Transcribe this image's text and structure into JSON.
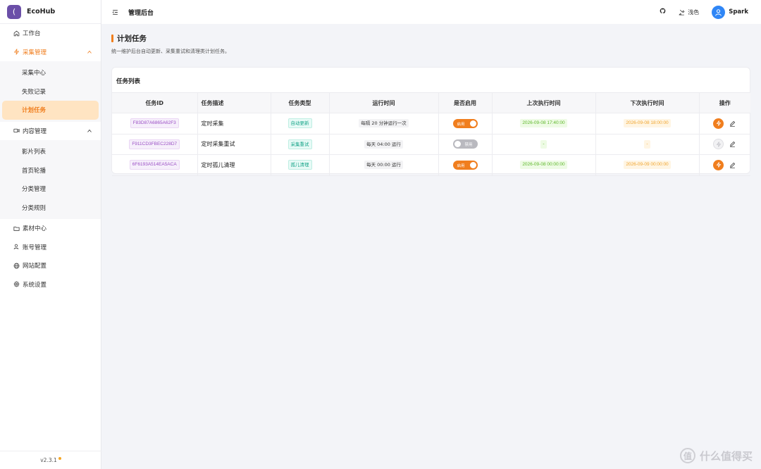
{
  "brand": {
    "logo_glyph": "(",
    "name": "EcoHub",
    "logo_color": "#6b4fa8"
  },
  "header": {
    "title": "管理后台",
    "theme_label": "浅色",
    "user_name": "Spark"
  },
  "sidebar": {
    "items": [
      {
        "label": "工作台",
        "icon": "home-icon"
      },
      {
        "label": "采集管理",
        "icon": "lightning-icon",
        "expanded": true,
        "children": [
          "采集中心",
          "失败记录",
          "计划任务"
        ]
      },
      {
        "label": "内容管理",
        "icon": "video-icon",
        "expanded": true,
        "children": [
          "影片列表",
          "首页轮播",
          "分类管理",
          "分类规则"
        ]
      },
      {
        "label": "素材中心",
        "icon": "folder-icon"
      },
      {
        "label": "账号管理",
        "icon": "user-icon"
      },
      {
        "label": "网站配置",
        "icon": "globe-icon"
      },
      {
        "label": "系统设置",
        "icon": "gear-icon"
      }
    ],
    "active_child": "计划任务",
    "version": "v2.3.1"
  },
  "page": {
    "title": "计划任务",
    "description": "统一维护后台自动更新、采集重试和清理类计划任务。"
  },
  "card": {
    "title": "任务列表"
  },
  "table": {
    "headers": [
      "任务ID",
      "任务描述",
      "任务类型",
      "运行时间",
      "是否启用",
      "上次执行时间",
      "下次执行时间",
      "操作"
    ],
    "rows": [
      {
        "id": "F83D87A6865A62F3",
        "desc": "定时采集",
        "type": "自动更新",
        "schedule": "每隔 20 分钟运行一次",
        "enabled": true,
        "switch_label": "启用",
        "last_run": "2026-09-08 17:40:00",
        "next_run": "2026-09-08 18:00:00"
      },
      {
        "id": "F911CD3FBEC228D7",
        "desc": "定时采集重试",
        "type": "采集重试",
        "schedule": "每天 04:00 运行",
        "enabled": false,
        "switch_label": "禁用",
        "last_run": "-",
        "next_run": "-"
      },
      {
        "id": "6F6193A514EA5ACA",
        "desc": "定时孤儿清理",
        "type": "孤儿清理",
        "schedule": "每天 00:00 运行",
        "enabled": true,
        "switch_label": "启用",
        "last_run": "2026-09-08 00:00:00",
        "next_run": "2026-09-09 00:00:00"
      }
    ]
  },
  "watermark": {
    "text": "什么值得买",
    "glyph": "值"
  },
  "colors": {
    "accent": "#f07e1e",
    "active_bg": "#ffe4c2",
    "avatar": "#2f86f6"
  }
}
